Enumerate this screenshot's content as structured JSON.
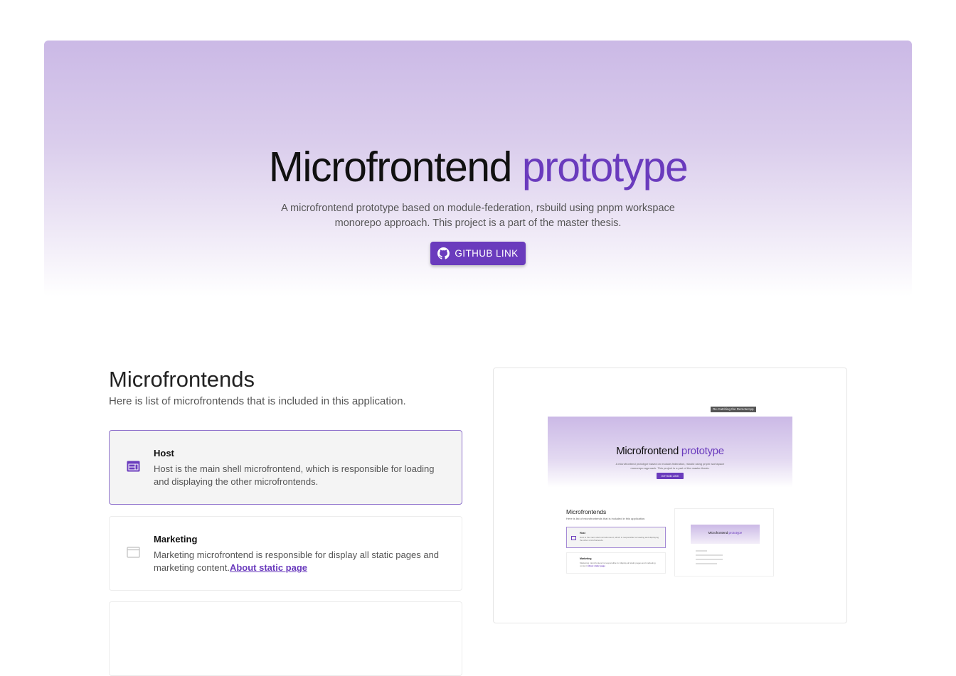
{
  "hero": {
    "title_main": "Microfrontend",
    "title_accent": "prototype",
    "description_line1": "A microfrontend prototype based on module-federation, rsbuild using pnpm workspace",
    "description_line2": "monorepo approach. This project is a part of the master thesis.",
    "button_label": "GITHUB LINK",
    "button_icon": "github-icon",
    "accent_color": "#6a3bbd"
  },
  "microfrontends": {
    "title": "Microfrontends",
    "subtitle": "Here is list of microfrontends that is included in this application.",
    "items": [
      {
        "name": "Host",
        "description": "Host is the main shell microfrontend, which is responsible for loading and displaying the other microfrontends.",
        "icon": "web-window-icon",
        "selected": true
      },
      {
        "name": "Marketing",
        "description": "Marketing microfrontend is responsible for display all static pages and marketing content.",
        "link_label": "About static page",
        "icon": "window-outline-icon",
        "selected": false
      }
    ]
  },
  "preview": {
    "tooltip": "Re-Catching the RemoteApp",
    "title_main": "Microfrontend",
    "title_accent": "prototype",
    "description_line1": "A microfrontend prototype based on module-federation, rsbuild using pnpm workspace",
    "description_line2": "monorepo approach. This project is a part of the master thesis.",
    "button_label": "GITHUB LINK",
    "section_title": "Microfrontends",
    "section_subtitle": "Here is list of microfrontends that is included in this application.",
    "items": [
      {
        "name": "Host",
        "description": "Host is the main shell microfrontend, which is responsible for loading and displaying the other microfrontends."
      },
      {
        "name": "Marketing",
        "description": "Marketing microfrontend is responsible for display all static pages and marketing content.",
        "link_label": "About static page"
      }
    ],
    "nested_title_main": "Microfrontend",
    "nested_title_accent": "prototype"
  }
}
